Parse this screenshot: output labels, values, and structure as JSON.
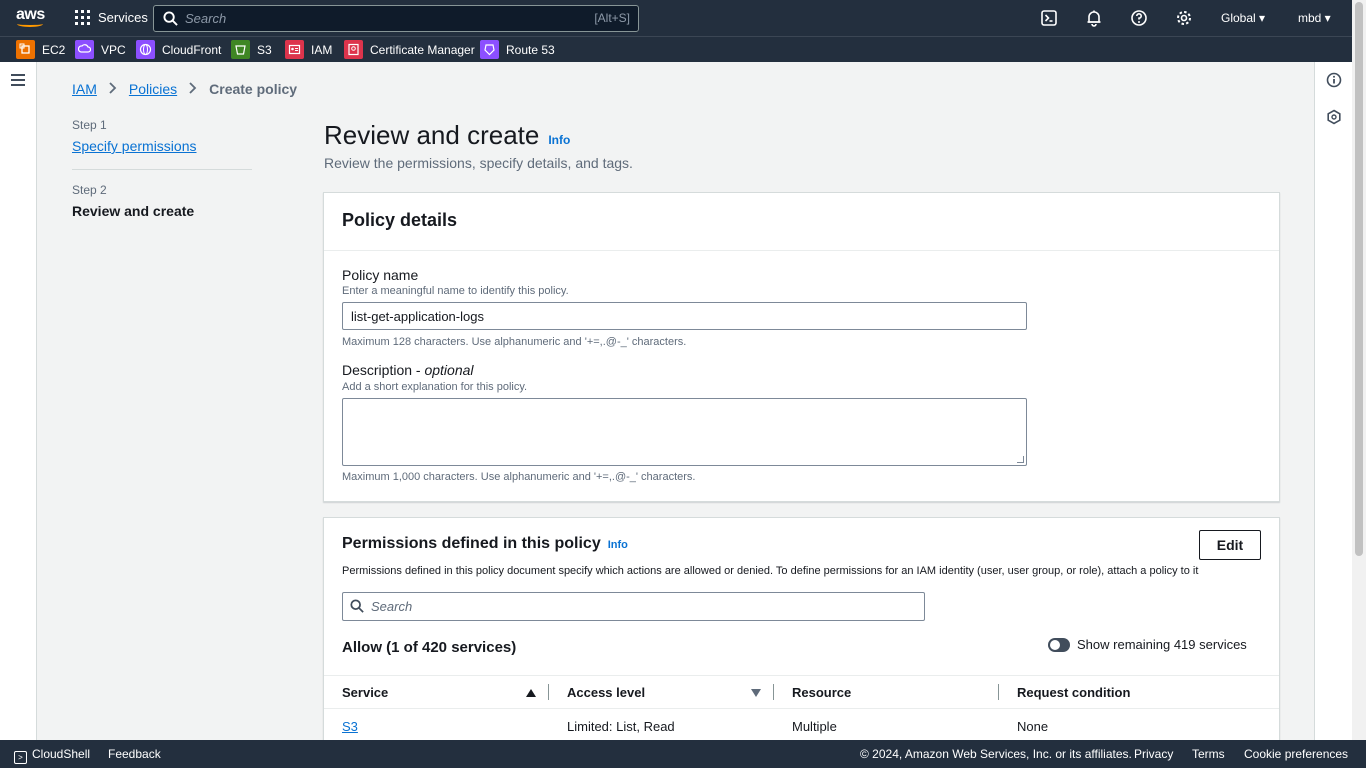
{
  "topnav": {
    "logo_text": "aws",
    "services_label": "Services",
    "search_placeholder": "Search",
    "search_shortcut": "[Alt+S]",
    "region": "Global ▾",
    "user": "mbd ▾"
  },
  "favorites": [
    {
      "label": "EC2",
      "color": "#ed7100"
    },
    {
      "label": "VPC",
      "color": "#8c4fff"
    },
    {
      "label": "CloudFront",
      "color": "#8c4fff"
    },
    {
      "label": "S3",
      "color": "#3f8624"
    },
    {
      "label": "IAM",
      "color": "#dd344c"
    },
    {
      "label": "Certificate Manager",
      "color": "#dd344c"
    },
    {
      "label": "Route 53",
      "color": "#8c4fff"
    }
  ],
  "breadcrumb": {
    "iam": "IAM",
    "policies": "Policies",
    "current": "Create policy"
  },
  "steps": {
    "step1_label": "Step 1",
    "step1_link": "Specify permissions",
    "step2_label": "Step 2",
    "step2_current": "Review and create"
  },
  "page": {
    "title": "Review and create",
    "info": "Info",
    "subtitle": "Review the permissions, specify details, and tags."
  },
  "policy_details": {
    "heading": "Policy details",
    "name_label": "Policy name",
    "name_desc": "Enter a meaningful name to identify this policy.",
    "name_value": "list-get-application-logs",
    "name_constraint": "Maximum 128 characters. Use alphanumeric and '+=,.@-_' characters.",
    "description_label": "Description - ",
    "description_optional": "optional",
    "description_desc": "Add a short explanation for this policy.",
    "description_value": "",
    "description_constraint": "Maximum 1,000 characters. Use alphanumeric and '+=,.@-_' characters."
  },
  "permissions": {
    "heading": "Permissions defined in this policy",
    "info": "Info",
    "edit_label": "Edit",
    "description": "Permissions defined in this policy document specify which actions are allowed or denied. To define permissions for an IAM identity (user, user group, or role), attach a policy to it",
    "search_placeholder": "Search",
    "allow_title": "Allow (1 of 420 services)",
    "toggle_label": "Show remaining 419 services",
    "columns": [
      "Service",
      "Access level",
      "Resource",
      "Request condition"
    ],
    "rows": [
      {
        "service": "S3",
        "access_level": "Limited: List, Read",
        "resource": "Multiple",
        "request_condition": "None"
      }
    ]
  },
  "footer": {
    "cloudshell": "CloudShell",
    "feedback": "Feedback",
    "copyright": "© 2024, Amazon Web Services, Inc. or its affiliates.",
    "privacy": "Privacy",
    "terms": "Terms",
    "cookies": "Cookie preferences"
  }
}
